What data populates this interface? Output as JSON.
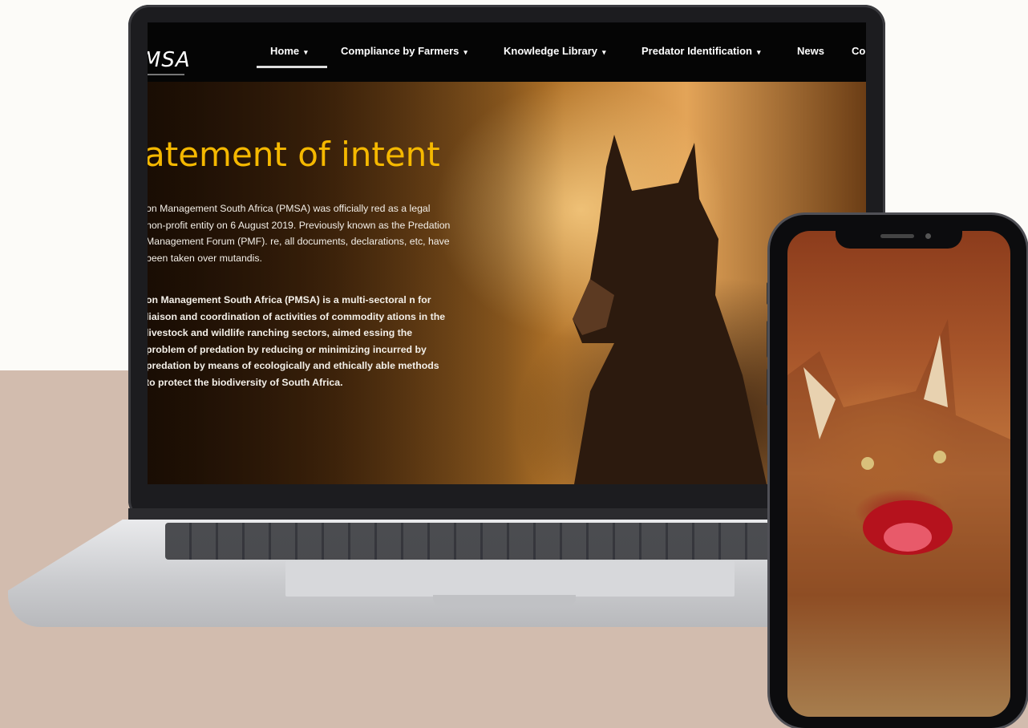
{
  "site": {
    "logo_text": "MSA",
    "nav": [
      {
        "label": "Home",
        "caret": "▾"
      },
      {
        "label": "Compliance by Farmers",
        "caret": "▾"
      },
      {
        "label": "Knowledge Library",
        "caret": "▾"
      },
      {
        "label": "Predator Identification",
        "caret": "▾"
      },
      {
        "label": "News",
        "caret": ""
      },
      {
        "label": "Co",
        "caret": ""
      }
    ],
    "hero": {
      "title": "atement of intent",
      "paragraph_1": "on Management South Africa (PMSA) was officially red as a legal non-profit entity on 6 August 2019.  Previously known as the Predation Management Forum (PMF). re, all documents, declarations, etc, have been taken over mutandis.",
      "paragraph_2": "on Management South Africa (PMSA) is a multi-sectoral n for liaison and coordination of activities of commodity ations in the livestock and wildlife ranching sectors, aimed essing the problem of predation by reducing or minimizing incurred by predation by means of ecologically and ethically able methods to protect the biodiversity of South Africa."
    }
  },
  "colors": {
    "accent_title": "#f5b800",
    "nav_bg": "#050505",
    "floor": "#d2bcae"
  },
  "images": {
    "laptop_photo": "caracal-portrait-photo",
    "phone_photo": "snarling-caracal-photo"
  }
}
